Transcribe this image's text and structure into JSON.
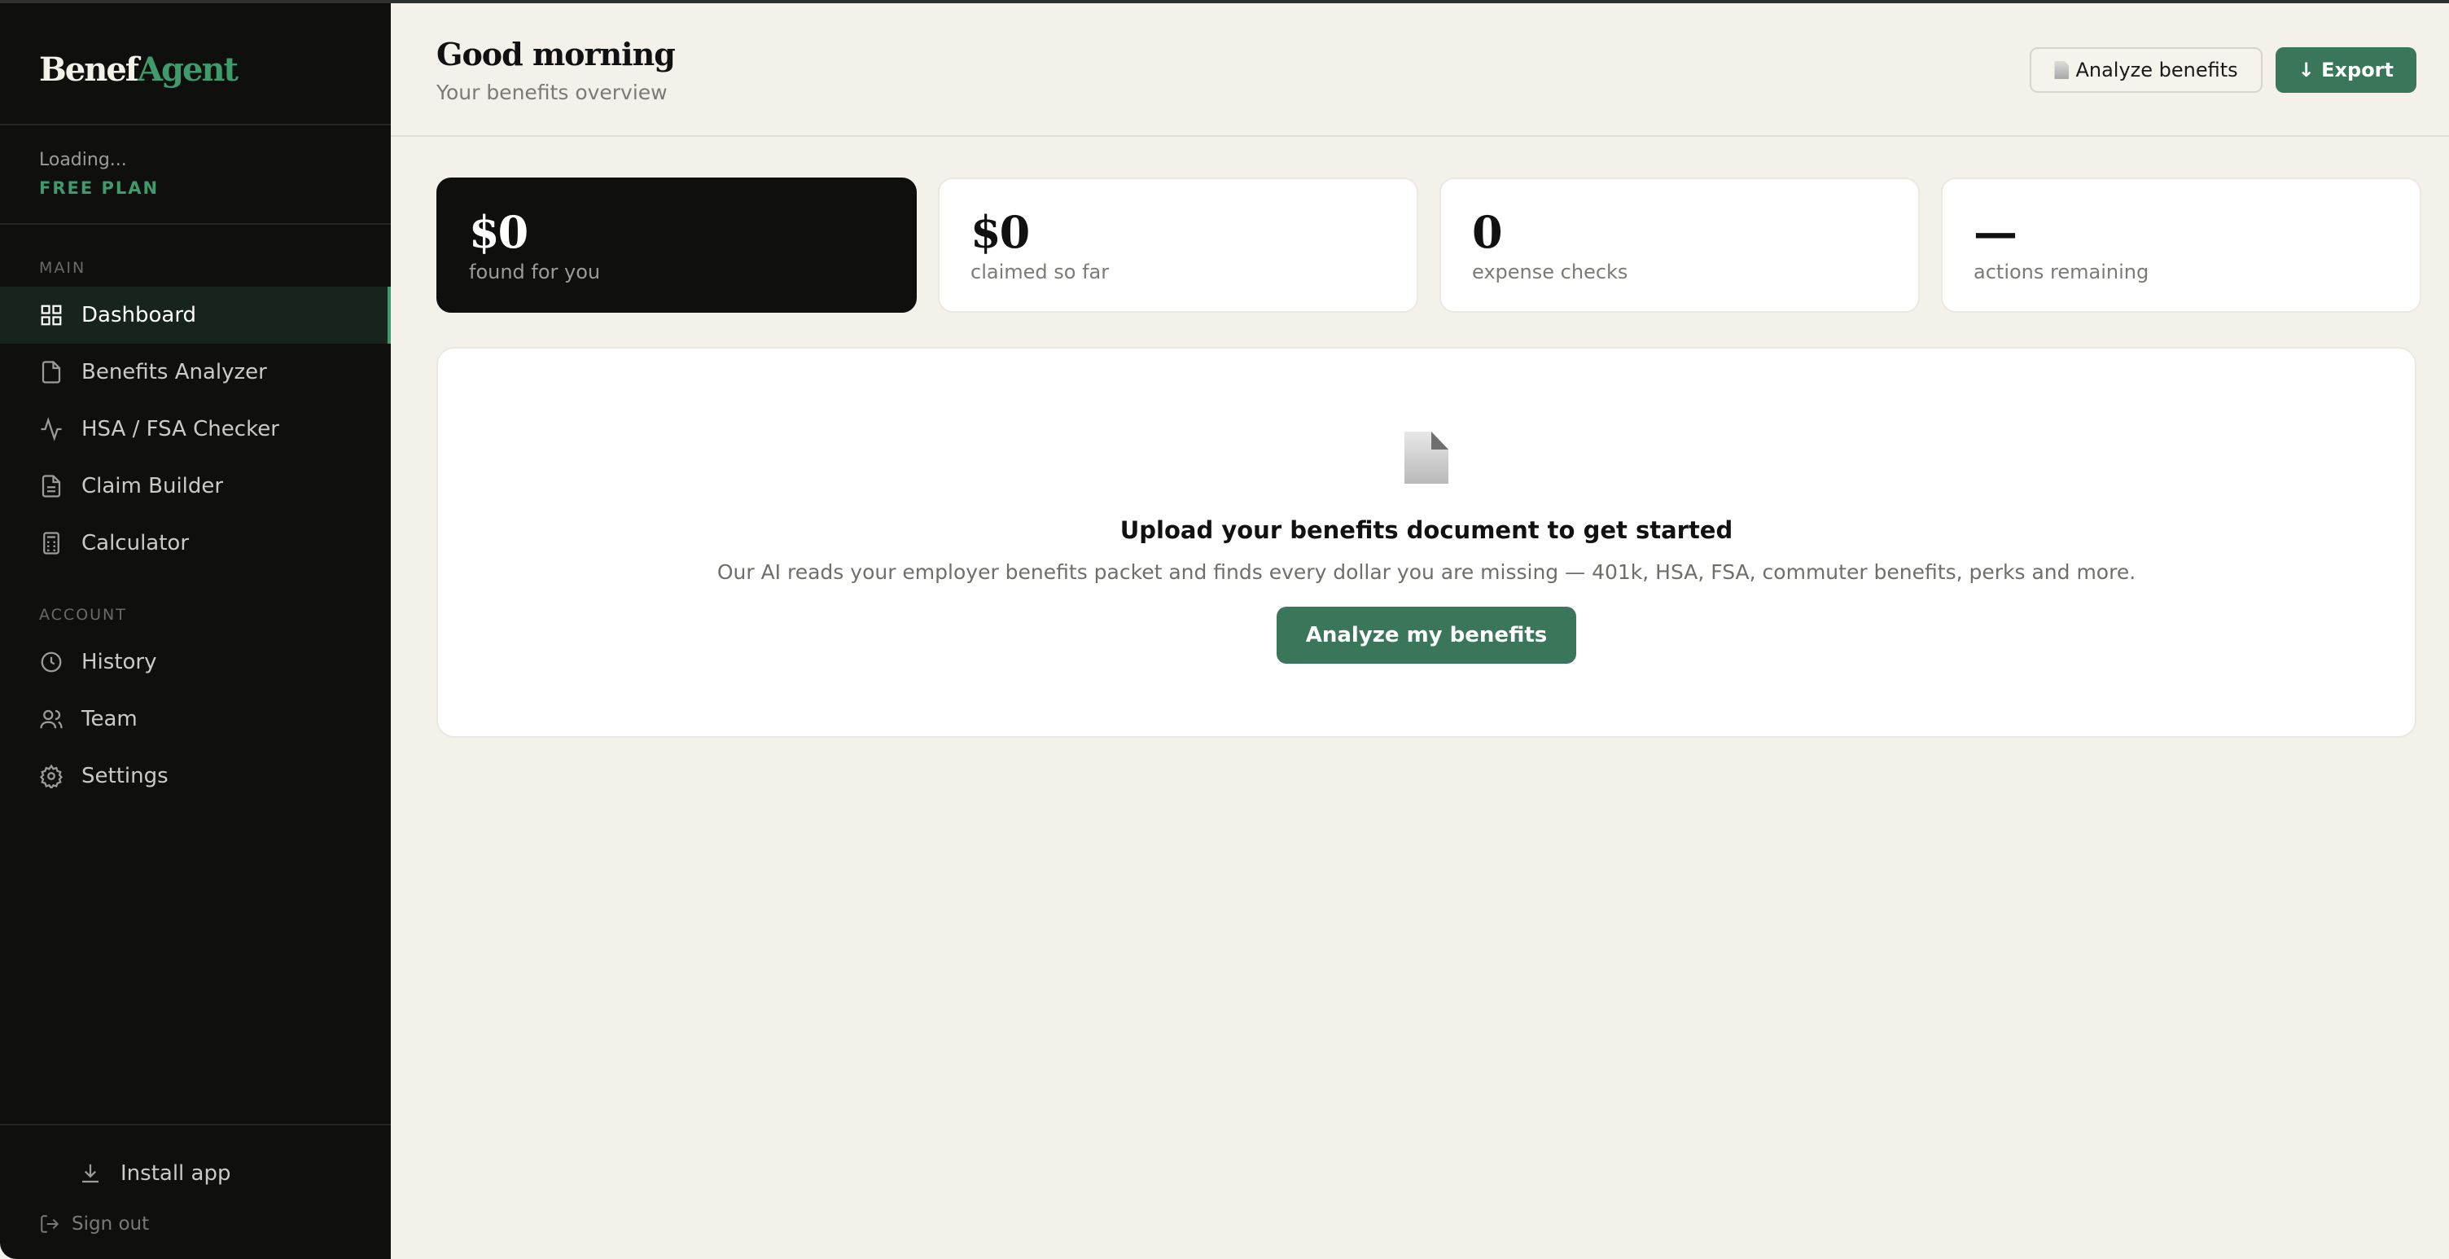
{
  "brand": {
    "part1": "Benef",
    "part2": "Agent",
    "accent": "#3f9a6c"
  },
  "user": {
    "name": "Loading...",
    "plan": "FREE PLAN"
  },
  "sidebar": {
    "main_label": "MAIN",
    "main_items": [
      {
        "label": "Dashboard",
        "icon": "grid-icon",
        "active": true
      },
      {
        "label": "Benefits Analyzer",
        "icon": "document-icon"
      },
      {
        "label": "HSA / FSA Checker",
        "icon": "activity-icon"
      },
      {
        "label": "Claim Builder",
        "icon": "file-text-icon"
      },
      {
        "label": "Calculator",
        "icon": "calculator-icon"
      }
    ],
    "account_label": "ACCOUNT",
    "account_items": [
      {
        "label": "History",
        "icon": "clock-icon"
      },
      {
        "label": "Team",
        "icon": "users-icon"
      },
      {
        "label": "Settings",
        "icon": "gear-icon"
      }
    ],
    "install_label": "Install app",
    "signout_label": "Sign out"
  },
  "header": {
    "title": "Good morning",
    "subtitle": "Your benefits overview",
    "analyze_label": "Analyze benefits",
    "export_label": "↓ Export"
  },
  "stats": [
    {
      "value": "$0",
      "label": "found for you"
    },
    {
      "value": "$0",
      "label": "claimed so far"
    },
    {
      "value": "0",
      "label": "expense checks"
    },
    {
      "value": "—",
      "label": "actions remaining"
    }
  ],
  "empty_state": {
    "title": "Upload your benefits document to get started",
    "description": "Our AI reads your employer benefits packet and finds every dollar you are missing — 401k, HSA, FSA, commuter benefits, perks and more.",
    "cta_label": "Analyze my benefits"
  }
}
